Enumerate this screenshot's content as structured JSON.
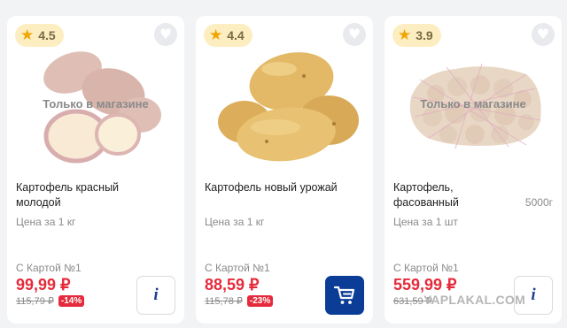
{
  "products": [
    {
      "rating": "4.5",
      "badge": "Только в магазине",
      "name": "Картофель красный молодой",
      "weight": "",
      "unit_price": "Цена за 1 кг",
      "card_label": "С Картой №1",
      "price": "99,99 ₽",
      "old_price": "115,79 ₽",
      "discount": "-14%",
      "action_icon": "info-icon",
      "action_label": "i"
    },
    {
      "rating": "4.4",
      "badge": "",
      "name": "Картофель новый урожай",
      "weight": "",
      "unit_price": "Цена за 1 кг",
      "card_label": "С Картой №1",
      "price": "88,59 ₽",
      "old_price": "115,78 ₽",
      "discount": "-23%",
      "action_icon": "cart-icon",
      "action_label": ""
    },
    {
      "rating": "3.9",
      "badge": "Только в магазине",
      "name": "Картофель, фасованный",
      "weight": "5000г",
      "unit_price": "Цена за 1 шт",
      "card_label": "С Картой №1",
      "price": "559,99 ₽",
      "old_price": "631,59 ₽",
      "discount": "",
      "action_icon": "info-icon",
      "action_label": "i"
    }
  ],
  "icons": {
    "star": "★",
    "heart": "♥"
  },
  "colors": {
    "accent_red": "#e52b3b",
    "brand_blue": "#0b3c96",
    "rating_bg": "#fdeec1",
    "star": "#f0a500"
  },
  "watermark": "YAPLAKAL.COM"
}
